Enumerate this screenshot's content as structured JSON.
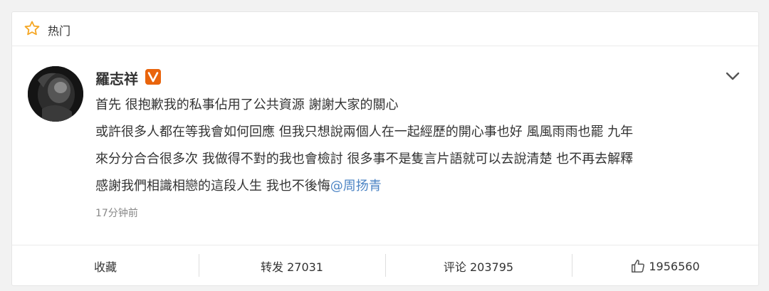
{
  "header": {
    "title": "热门",
    "icon": "star-outline-icon"
  },
  "post": {
    "username": "羅志祥",
    "verified_icon": "verified-v-badge-icon",
    "lines": [
      "首先 很抱歉我的私事佔用了公共資源 謝謝大家的關心",
      "或許很多人都在等我會如何回應 但我只想說兩個人在一起經歷的開心事也好 風風雨雨也罷 九年",
      "來分分合合很多次 我做得不對的我也會檢討 很多事不是隻言片語就可以去說清楚 也不再去解釋",
      "感謝我們相識相戀的這段人生 我也不後悔"
    ],
    "mention": "@周扬青",
    "timestamp": "17分钟前"
  },
  "footer": {
    "favorite": "收藏",
    "repost": "转发 27031",
    "comment": "评论 203795",
    "like": "1956560"
  },
  "colors": {
    "mention": "#4c84c4",
    "badge": "#e9640c",
    "star": "#f5a623"
  }
}
